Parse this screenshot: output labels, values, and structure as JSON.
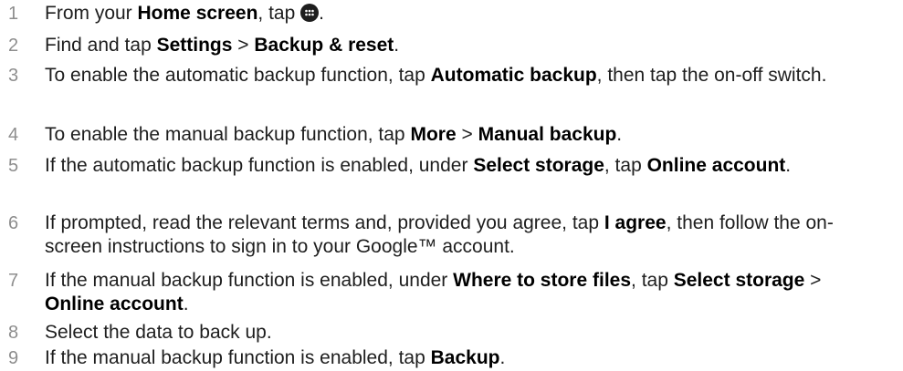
{
  "steps": [
    {
      "number": "1",
      "parts": [
        "From your ",
        "Home screen",
        ", tap ",
        "."
      ],
      "icon": "apps-grid-icon"
    },
    {
      "number": "2",
      "parts": [
        "Find and tap ",
        "Settings",
        " > ",
        "Backup & reset",
        "."
      ]
    },
    {
      "number": "3",
      "parts": [
        "To enable the automatic backup function, tap ",
        "Automatic backup",
        ", then tap the on-off switch."
      ]
    },
    {
      "number": "4",
      "parts": [
        "To enable the manual backup function, tap ",
        "More",
        " > ",
        "Manual backup",
        "."
      ]
    },
    {
      "number": "5",
      "parts": [
        "If the automatic backup function is enabled, under ",
        "Select storage",
        ", tap ",
        "Online account",
        "."
      ]
    },
    {
      "number": "6",
      "parts": [
        "If prompted, read the relevant terms and, provided you agree, tap ",
        "I agree",
        ", then follow the on-screen instructions to sign in to your Google™ account."
      ]
    },
    {
      "number": "7",
      "parts": [
        "If the manual backup function is enabled, under ",
        "Where to store files",
        ", tap ",
        "Select storage",
        " > ",
        "Online account",
        "."
      ]
    },
    {
      "number": "8",
      "parts": [
        "Select the data to back up."
      ]
    },
    {
      "number": "9",
      "parts": [
        "If the manual backup function is enabled, tap ",
        "Backup",
        "."
      ]
    }
  ]
}
